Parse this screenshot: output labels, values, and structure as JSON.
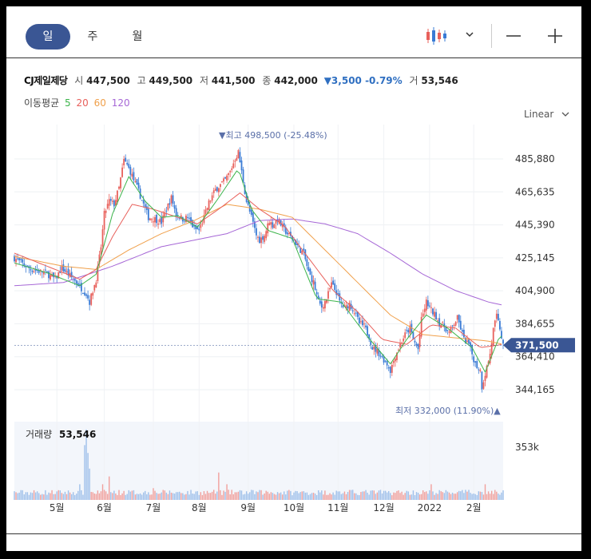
{
  "tabs": [
    {
      "label": "일",
      "active": true
    },
    {
      "label": "주",
      "active": false
    },
    {
      "label": "월",
      "active": false
    }
  ],
  "quote": {
    "name": "CJ제일제당",
    "open_label": "시",
    "open": "447,500",
    "high_label": "고",
    "high": "449,500",
    "low_label": "저",
    "low": "441,500",
    "close_label": "종",
    "close": "442,000",
    "change": "▼3,500 -0.79%",
    "volume_label": "거",
    "volume": "53,546"
  },
  "ma": {
    "label": "이동평균",
    "p5": "5",
    "p20": "20",
    "p60": "60",
    "p120": "120",
    "colors": {
      "p5": "#3cb44b",
      "p20": "#e8605b",
      "p60": "#f0a04b",
      "p120": "#a667d6"
    }
  },
  "scale": {
    "label": "Linear",
    "icon": "chevron-down-icon"
  },
  "chart_data": {
    "type": "candlestick",
    "price_ticks": [
      "485,880",
      "465,635",
      "445,390",
      "425,145",
      "404,900",
      "384,655",
      "364,410",
      "344,165"
    ],
    "price_tick_values": [
      485880,
      465635,
      445390,
      425145,
      404900,
      384655,
      364410,
      344165
    ],
    "current_price_label": "371,500",
    "current_price": 371500,
    "high_annotation": "▼최고 498,500 (-25.48%)",
    "high_value": 498500,
    "low_annotation": "최저 332,000 (11.90%)▲",
    "low_value": 332000,
    "x_labels": [
      "5월",
      "6월",
      "7월",
      "8월",
      "9월",
      "10월",
      "11월",
      "12월",
      "2022",
      "2월"
    ],
    "volume_label": "거래량",
    "volume_value": "53,546",
    "volume_tick": "353k",
    "up_color": "#e8605b",
    "down_color": "#3a7bd5",
    "close_path": [
      [
        0,
        425000
      ],
      [
        10,
        418000
      ],
      [
        19,
        416000
      ],
      [
        25,
        412000
      ],
      [
        29,
        419000
      ],
      [
        33,
        415000
      ],
      [
        38,
        410000
      ],
      [
        44,
        403000
      ],
      [
        46,
        398000
      ],
      [
        50,
        412000
      ],
      [
        53,
        432000
      ],
      [
        55,
        452000
      ],
      [
        58,
        460000
      ],
      [
        61,
        458000
      ],
      [
        64,
        468000
      ],
      [
        67,
        485000
      ],
      [
        69,
        482000
      ],
      [
        71,
        478000
      ],
      [
        73,
        473000
      ],
      [
        76,
        466000
      ],
      [
        79,
        458000
      ],
      [
        82,
        450000
      ],
      [
        86,
        449000
      ],
      [
        90,
        447000
      ],
      [
        93,
        455000
      ],
      [
        96,
        462000
      ],
      [
        99,
        452000
      ],
      [
        103,
        449000
      ],
      [
        106,
        450000
      ],
      [
        110,
        443000
      ],
      [
        113,
        442000
      ],
      [
        116,
        450000
      ],
      [
        119,
        459000
      ],
      [
        123,
        467000
      ],
      [
        126,
        470000
      ],
      [
        129,
        473000
      ],
      [
        132,
        478000
      ],
      [
        135,
        486000
      ],
      [
        137,
        490000
      ],
      [
        139,
        478000
      ],
      [
        142,
        460000
      ],
      [
        145,
        450000
      ],
      [
        148,
        439000
      ],
      [
        150,
        436000
      ],
      [
        153,
        439000
      ],
      [
        156,
        448000
      ],
      [
        158,
        445000
      ],
      [
        161,
        449000
      ],
      [
        164,
        444000
      ],
      [
        167,
        440000
      ],
      [
        171,
        436000
      ],
      [
        174,
        431000
      ],
      [
        177,
        428000
      ],
      [
        180,
        416000
      ],
      [
        183,
        410000
      ],
      [
        186,
        398000
      ],
      [
        188,
        395000
      ],
      [
        191,
        400000
      ],
      [
        194,
        409000
      ],
      [
        197,
        404000
      ],
      [
        199,
        398000
      ],
      [
        202,
        394000
      ],
      [
        205,
        397000
      ],
      [
        208,
        392000
      ],
      [
        211,
        385000
      ],
      [
        214,
        383000
      ],
      [
        217,
        377000
      ],
      [
        219,
        370000
      ],
      [
        222,
        368000
      ],
      [
        225,
        364000
      ],
      [
        228,
        360000
      ],
      [
        230,
        356000
      ],
      [
        233,
        365000
      ],
      [
        236,
        372000
      ],
      [
        239,
        378000
      ],
      [
        242,
        382000
      ],
      [
        244,
        375000
      ],
      [
        247,
        369000
      ],
      [
        249,
        387000
      ],
      [
        252,
        398000
      ],
      [
        255,
        393000
      ],
      [
        258,
        389000
      ],
      [
        260,
        385000
      ],
      [
        263,
        383000
      ],
      [
        266,
        379000
      ],
      [
        268,
        383000
      ],
      [
        271,
        388000
      ],
      [
        273,
        382000
      ],
      [
        275,
        375000
      ],
      [
        278,
        372000
      ],
      [
        280,
        366000
      ],
      [
        282,
        360000
      ],
      [
        285,
        356000
      ],
      [
        286,
        346000
      ],
      [
        289,
        358000
      ],
      [
        291,
        366000
      ],
      [
        293,
        381000
      ],
      [
        295,
        389000
      ],
      [
        297,
        382000
      ],
      [
        299,
        371000
      ]
    ],
    "ma_paths": {
      "p5": [
        [
          0,
          422000
        ],
        [
          20,
          416000
        ],
        [
          40,
          408000
        ],
        [
          50,
          415000
        ],
        [
          60,
          452000
        ],
        [
          70,
          475000
        ],
        [
          80,
          460000
        ],
        [
          90,
          450000
        ],
        [
          100,
          451000
        ],
        [
          112,
          444000
        ],
        [
          125,
          462000
        ],
        [
          137,
          480000
        ],
        [
          145,
          455000
        ],
        [
          155,
          442000
        ],
        [
          170,
          437000
        ],
        [
          185,
          400000
        ],
        [
          200,
          398000
        ],
        [
          215,
          378000
        ],
        [
          230,
          360000
        ],
        [
          240,
          375000
        ],
        [
          252,
          390000
        ],
        [
          265,
          382000
        ],
        [
          280,
          370000
        ],
        [
          288,
          355000
        ],
        [
          296,
          375000
        ],
        [
          299,
          378000
        ]
      ],
      "p20": [
        [
          0,
          428000
        ],
        [
          20,
          420000
        ],
        [
          40,
          412000
        ],
        [
          50,
          418000
        ],
        [
          60,
          438000
        ],
        [
          72,
          458000
        ],
        [
          85,
          455000
        ],
        [
          100,
          450000
        ],
        [
          112,
          446000
        ],
        [
          125,
          455000
        ],
        [
          138,
          465000
        ],
        [
          150,
          455000
        ],
        [
          165,
          445000
        ],
        [
          180,
          425000
        ],
        [
          195,
          405000
        ],
        [
          210,
          392000
        ],
        [
          225,
          375000
        ],
        [
          240,
          372000
        ],
        [
          255,
          384000
        ],
        [
          270,
          382000
        ],
        [
          285,
          370000
        ],
        [
          299,
          372000
        ]
      ],
      "p60": [
        [
          0,
          426000
        ],
        [
          30,
          420000
        ],
        [
          50,
          418000
        ],
        [
          70,
          430000
        ],
        [
          90,
          440000
        ],
        [
          110,
          448000
        ],
        [
          130,
          458000
        ],
        [
          150,
          455000
        ],
        [
          170,
          450000
        ],
        [
          190,
          430000
        ],
        [
          210,
          410000
        ],
        [
          230,
          390000
        ],
        [
          250,
          378000
        ],
        [
          270,
          376000
        ],
        [
          290,
          374000
        ],
        [
          299,
          372000
        ]
      ],
      "p120": [
        [
          0,
          408000
        ],
        [
          30,
          410000
        ],
        [
          60,
          420000
        ],
        [
          90,
          432000
        ],
        [
          110,
          436000
        ],
        [
          130,
          440000
        ],
        [
          150,
          448000
        ],
        [
          170,
          449000
        ],
        [
          190,
          446000
        ],
        [
          210,
          440000
        ],
        [
          230,
          428000
        ],
        [
          250,
          415000
        ],
        [
          270,
          405000
        ],
        [
          290,
          398000
        ],
        [
          299,
          396000
        ]
      ]
    },
    "volume_spikes": [
      [
        40,
        0.2
      ],
      [
        43,
        0.7
      ],
      [
        44,
        0.9
      ],
      [
        45,
        0.6
      ],
      [
        46,
        0.4
      ],
      [
        54,
        0.2
      ],
      [
        58,
        0.3
      ],
      [
        85,
        0.15
      ],
      [
        125,
        0.35
      ],
      [
        130,
        0.2
      ],
      [
        255,
        0.2
      ],
      [
        288,
        0.2
      ]
    ]
  }
}
